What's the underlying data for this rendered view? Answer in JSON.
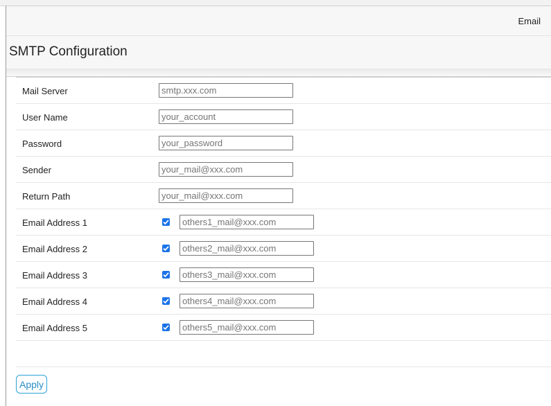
{
  "tabs": {
    "email": "Email"
  },
  "page": {
    "title": "SMTP Configuration"
  },
  "fields": [
    {
      "label": "Mail Server",
      "value": "smtp.xxx.com"
    },
    {
      "label": "User Name",
      "value": "your_account"
    },
    {
      "label": "Password",
      "value": "your_password"
    },
    {
      "label": "Sender",
      "value": "your_mail@xxx.com"
    },
    {
      "label": "Return Path",
      "value": "your_mail@xxx.com"
    }
  ],
  "addresses": [
    {
      "label": "Email Address 1",
      "checked": true,
      "value": "others1_mail@xxx.com"
    },
    {
      "label": "Email Address 2",
      "checked": true,
      "value": "others2_mail@xxx.com"
    },
    {
      "label": "Email Address 3",
      "checked": true,
      "value": "others3_mail@xxx.com"
    },
    {
      "label": "Email Address 4",
      "checked": true,
      "value": "others4_mail@xxx.com"
    },
    {
      "label": "Email Address 5",
      "checked": true,
      "value": "others5_mail@xxx.com"
    }
  ],
  "actions": {
    "apply_label": "Apply"
  },
  "colors": {
    "accent": "#2aa3d6",
    "checkbox": "#1a73e8"
  }
}
